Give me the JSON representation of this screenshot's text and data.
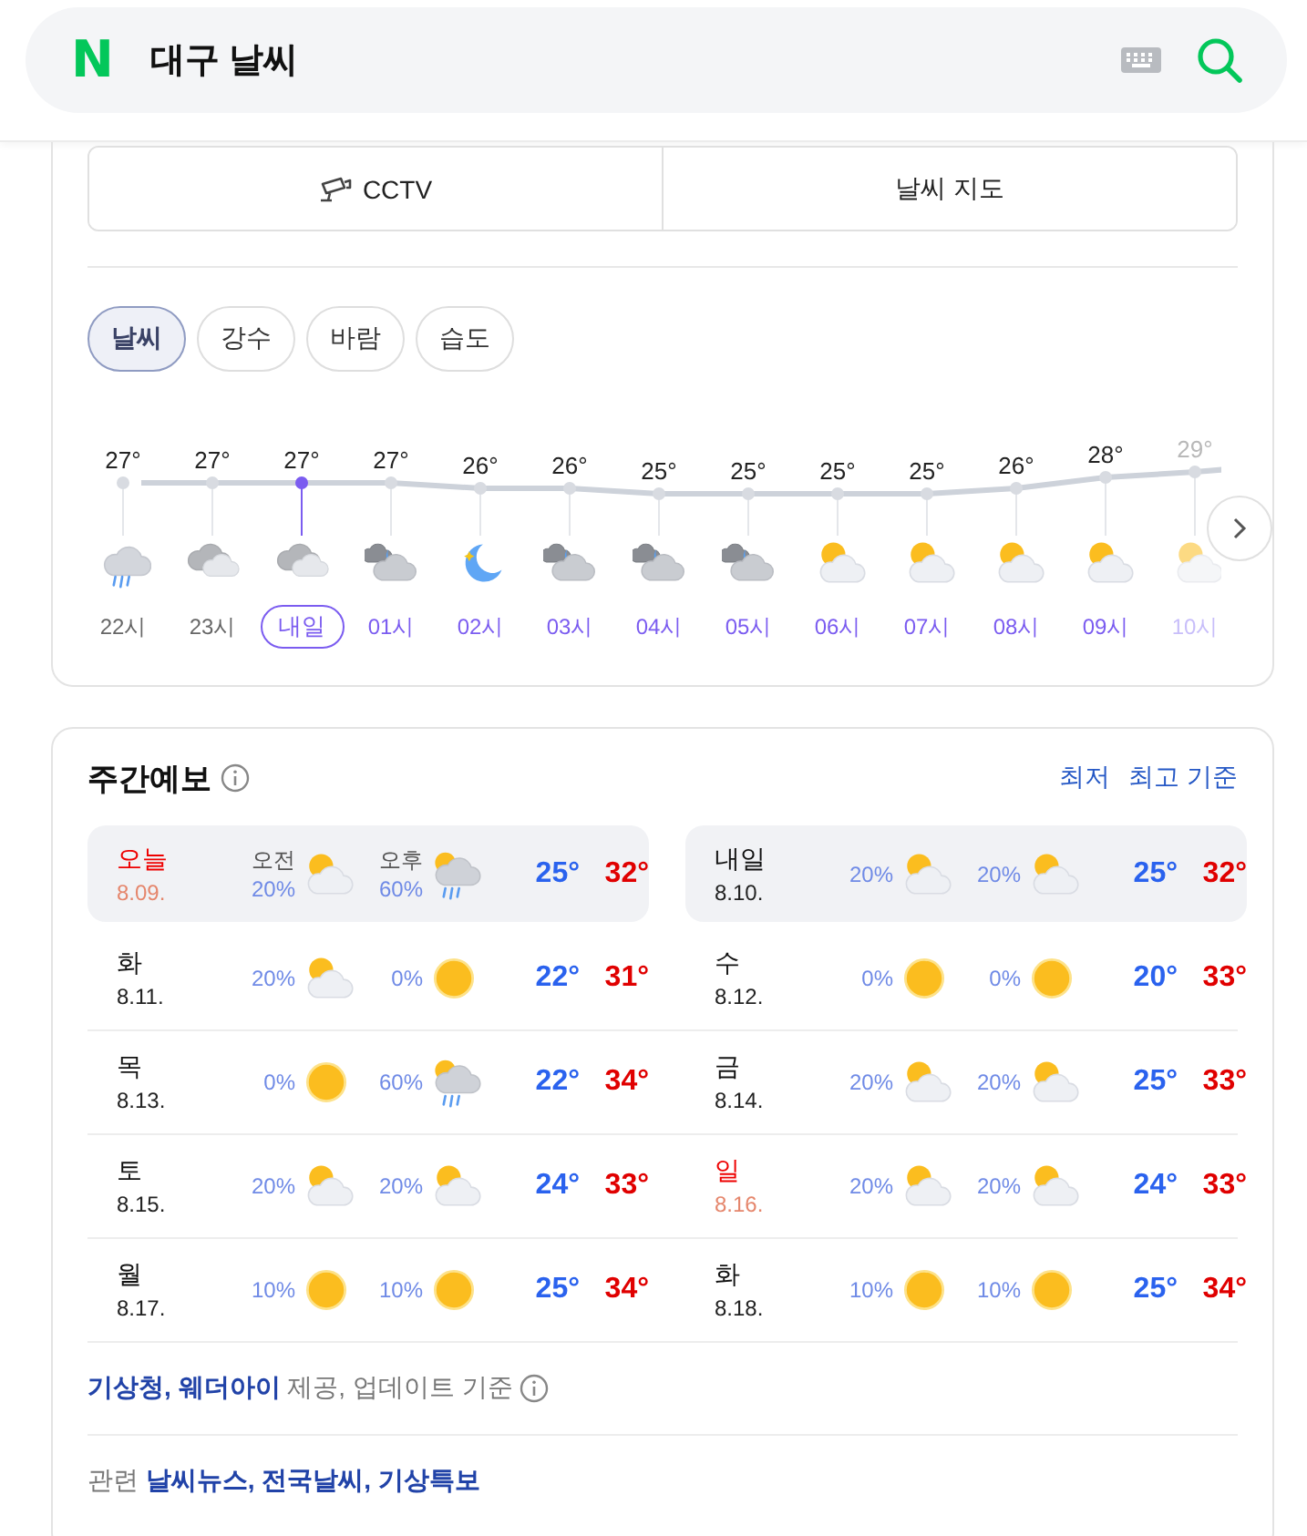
{
  "search": {
    "logo": "N",
    "query": "대구 날씨"
  },
  "weather": {
    "buttons": [
      "CCTV",
      "날씨 지도"
    ],
    "tabs": [
      {
        "label": "날씨",
        "selected": true
      },
      {
        "label": "강수",
        "selected": false
      },
      {
        "label": "바람",
        "selected": false
      },
      {
        "label": "습도",
        "selected": false
      }
    ],
    "hourly": [
      {
        "temp": "27°",
        "time": "22시",
        "color": "#666666",
        "kind": "rain",
        "selected": false,
        "faded": false
      },
      {
        "temp": "27°",
        "time": "23시",
        "color": "#666666",
        "kind": "cloudy",
        "selected": false,
        "faded": false
      },
      {
        "temp": "27°",
        "time": "내일",
        "color": "#7b5cf0",
        "kind": "cloudy",
        "selected": true,
        "faded": false
      },
      {
        "temp": "27°",
        "time": "01시",
        "color": "#7b5cf0",
        "kind": "nightcloud",
        "selected": false,
        "faded": false
      },
      {
        "temp": "26°",
        "time": "02시",
        "color": "#7b5cf0",
        "kind": "moon",
        "selected": false,
        "faded": false
      },
      {
        "temp": "26°",
        "time": "03시",
        "color": "#7b5cf0",
        "kind": "nightcloud",
        "selected": false,
        "faded": false
      },
      {
        "temp": "25°",
        "time": "04시",
        "color": "#7b5cf0",
        "kind": "nightcloud",
        "selected": false,
        "faded": false
      },
      {
        "temp": "25°",
        "time": "05시",
        "color": "#7b5cf0",
        "kind": "nightcloud",
        "selected": false,
        "faded": false
      },
      {
        "temp": "25°",
        "time": "06시",
        "color": "#7b5cf0",
        "kind": "partly",
        "selected": false,
        "faded": false
      },
      {
        "temp": "25°",
        "time": "07시",
        "color": "#7b5cf0",
        "kind": "partly",
        "selected": false,
        "faded": false
      },
      {
        "temp": "26°",
        "time": "08시",
        "color": "#7b5cf0",
        "kind": "partly",
        "selected": false,
        "faded": false
      },
      {
        "temp": "28°",
        "time": "09시",
        "color": "#7b5cf0",
        "kind": "partly",
        "selected": false,
        "faded": false
      },
      {
        "temp": "29°",
        "time": "10시",
        "color": "#c8befa",
        "kind": "partly",
        "selected": false,
        "faded": true
      }
    ]
  },
  "weekly": {
    "title": "주간예보",
    "sort_links": [
      "최저",
      "최고 기준"
    ],
    "days": [
      {
        "day": "오늘",
        "date": "8.09.",
        "red": true,
        "highlighted": true,
        "am": {
          "label": "오전",
          "pct": "20%",
          "kind": "partly"
        },
        "pm": {
          "label": "오후",
          "pct": "60%",
          "kind": "sunrain"
        },
        "low": "25°",
        "high": "32°"
      },
      {
        "day": "내일",
        "date": "8.10.",
        "red": false,
        "highlighted": true,
        "am": {
          "pct": "20%",
          "kind": "partly"
        },
        "pm": {
          "pct": "20%",
          "kind": "partly"
        },
        "low": "25°",
        "high": "32°"
      },
      {
        "day": "화",
        "date": "8.11.",
        "red": false,
        "highlighted": false,
        "am": {
          "pct": "20%",
          "kind": "partly"
        },
        "pm": {
          "pct": "0%",
          "kind": "sun"
        },
        "low": "22°",
        "high": "31°"
      },
      {
        "day": "수",
        "date": "8.12.",
        "red": false,
        "highlighted": false,
        "am": {
          "pct": "0%",
          "kind": "sun"
        },
        "pm": {
          "pct": "0%",
          "kind": "sun"
        },
        "low": "20°",
        "high": "33°"
      },
      {
        "day": "목",
        "date": "8.13.",
        "red": false,
        "highlighted": false,
        "am": {
          "pct": "0%",
          "kind": "sun"
        },
        "pm": {
          "pct": "60%",
          "kind": "sunrain"
        },
        "low": "22°",
        "high": "34°"
      },
      {
        "day": "금",
        "date": "8.14.",
        "red": false,
        "highlighted": false,
        "am": {
          "pct": "20%",
          "kind": "partly"
        },
        "pm": {
          "pct": "20%",
          "kind": "partly"
        },
        "low": "25°",
        "high": "33°"
      },
      {
        "day": "토",
        "date": "8.15.",
        "red": false,
        "highlighted": false,
        "am": {
          "pct": "20%",
          "kind": "partly"
        },
        "pm": {
          "pct": "20%",
          "kind": "partly"
        },
        "low": "24°",
        "high": "33°"
      },
      {
        "day": "일",
        "date": "8.16.",
        "red": true,
        "highlighted": false,
        "am": {
          "pct": "20%",
          "kind": "partly"
        },
        "pm": {
          "pct": "20%",
          "kind": "partly"
        },
        "low": "24°",
        "high": "33°"
      },
      {
        "day": "월",
        "date": "8.17.",
        "red": false,
        "highlighted": false,
        "am": {
          "pct": "10%",
          "kind": "sun"
        },
        "pm": {
          "pct": "10%",
          "kind": "sun"
        },
        "low": "25°",
        "high": "34°"
      },
      {
        "day": "화",
        "date": "8.18.",
        "red": false,
        "highlighted": false,
        "am": {
          "pct": "10%",
          "kind": "sun"
        },
        "pm": {
          "pct": "10%",
          "kind": "sun"
        },
        "low": "25°",
        "high": "34°"
      }
    ],
    "source": {
      "links": [
        "기상청,",
        "웨더아이"
      ],
      "text": "제공, 업데이트 기준"
    },
    "related": {
      "label": "관련",
      "links": [
        "날씨뉴스,",
        "전국날씨,",
        "기상특보"
      ]
    }
  }
}
